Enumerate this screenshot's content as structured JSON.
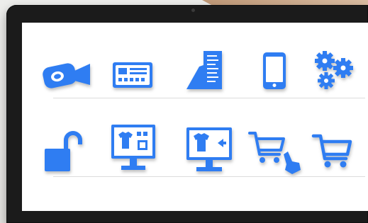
{
  "app": {
    "accent_color": "#2f7df2",
    "screen_background": "#ffffff",
    "bezel_color": "#1b1b1b"
  },
  "icons": {
    "row1": [
      {
        "name": "video-camera-icon"
      },
      {
        "name": "card-terminal-icon"
      },
      {
        "name": "hand-receipt-icon"
      },
      {
        "name": "tablet-device-icon"
      },
      {
        "name": "gears-icon"
      }
    ],
    "row2": [
      {
        "name": "unlocked-padlock-icon"
      },
      {
        "name": "monitor-shirt-options-icon"
      },
      {
        "name": "monitor-shirt-arrow-icon"
      },
      {
        "name": "cart-touch-icon"
      },
      {
        "name": "shopping-cart-icon"
      }
    ]
  }
}
